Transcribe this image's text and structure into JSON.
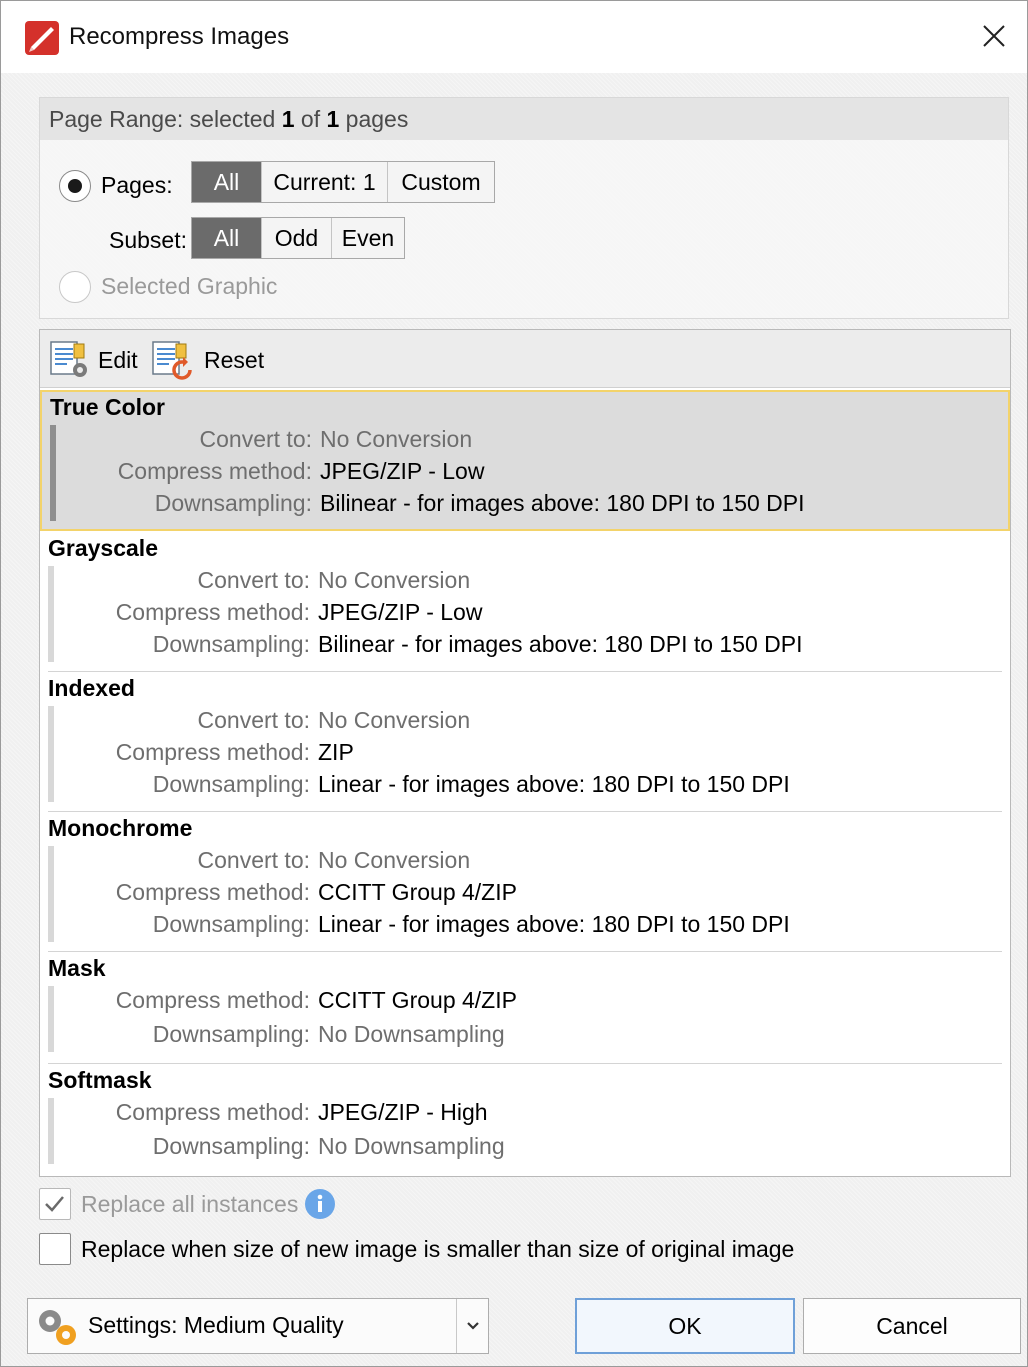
{
  "window": {
    "title": "Recompress Images"
  },
  "page_range": {
    "header_prefix": "Page Range: selected",
    "selected": "1",
    "of_text": "of",
    "total": "1",
    "pages_word": "pages",
    "pages_label": "Pages:",
    "pages_options": [
      "All",
      "Current: 1",
      "Custom"
    ],
    "subset_label": "Subset:",
    "subset_options": [
      "All",
      "Odd",
      "Even"
    ],
    "selected_graphic_label": "Selected Graphic"
  },
  "toolbar": {
    "edit_label": "Edit",
    "reset_label": "Reset"
  },
  "profiles": [
    {
      "name": "True Color",
      "rows": [
        {
          "key": "Convert to:",
          "value": "No Conversion"
        },
        {
          "key": "Compress method:",
          "value": "JPEG/ZIP - Low"
        },
        {
          "key": "Downsampling:",
          "value": "Bilinear - for images above: 180 DPI to 150 DPI"
        }
      ]
    },
    {
      "name": "Grayscale",
      "rows": [
        {
          "key": "Convert to:",
          "value": "No Conversion"
        },
        {
          "key": "Compress method:",
          "value": "JPEG/ZIP - Low"
        },
        {
          "key": "Downsampling:",
          "value": "Bilinear - for images above: 180 DPI to 150 DPI"
        }
      ]
    },
    {
      "name": "Indexed",
      "rows": [
        {
          "key": "Convert to:",
          "value": "No Conversion"
        },
        {
          "key": "Compress method:",
          "value": "ZIP"
        },
        {
          "key": "Downsampling:",
          "value": "Linear - for images above: 180 DPI to 150 DPI"
        }
      ]
    },
    {
      "name": "Monochrome",
      "rows": [
        {
          "key": "Convert to:",
          "value": "No Conversion"
        },
        {
          "key": "Compress method:",
          "value": "CCITT Group 4/ZIP"
        },
        {
          "key": "Downsampling:",
          "value": "Linear - for images above: 180 DPI to 150 DPI"
        }
      ]
    },
    {
      "name": "Mask",
      "rows": [
        {
          "key": "Compress method:",
          "value": "CCITT Group 4/ZIP"
        },
        {
          "key": "Downsampling:",
          "value": "No Downsampling"
        }
      ]
    },
    {
      "name": "Softmask",
      "rows": [
        {
          "key": "Compress method:",
          "value": "JPEG/ZIP - High"
        },
        {
          "key": "Downsampling:",
          "value": "No Downsampling"
        }
      ]
    }
  ],
  "options": {
    "replace_all_label": "Replace all instances",
    "replace_smaller_label": "Replace when size of new image is smaller than size of original image"
  },
  "footer": {
    "settings_label": "Settings:  Medium Quality",
    "ok_label": "OK",
    "cancel_label": "Cancel"
  }
}
